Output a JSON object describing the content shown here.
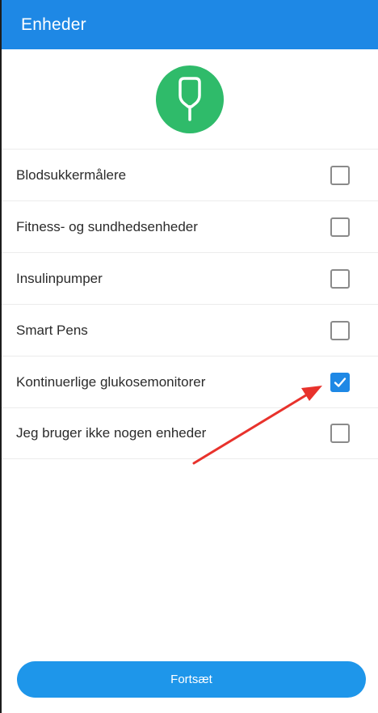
{
  "header": {
    "title": "Enheder"
  },
  "hero": {
    "icon": "glucose-meter-icon",
    "color": "#2fbb6a"
  },
  "devices": [
    {
      "label": "Blodsukkermålere",
      "checked": false
    },
    {
      "label": "Fitness- og sundhedsenheder",
      "checked": false
    },
    {
      "label": "Insulinpumper",
      "checked": false
    },
    {
      "label": "Smart Pens",
      "checked": false
    },
    {
      "label": "Kontinuerlige glukosemonitorer",
      "checked": true
    },
    {
      "label": "Jeg bruger ikke nogen enheder",
      "checked": false
    }
  ],
  "annotation": {
    "icon": "red-arrow-icon",
    "color": "#e8322c"
  },
  "footer": {
    "continue_label": "Fortsæt"
  },
  "colors": {
    "primary": "#1e88e5",
    "button": "#1e96ea",
    "text": "#2b2b2b"
  }
}
